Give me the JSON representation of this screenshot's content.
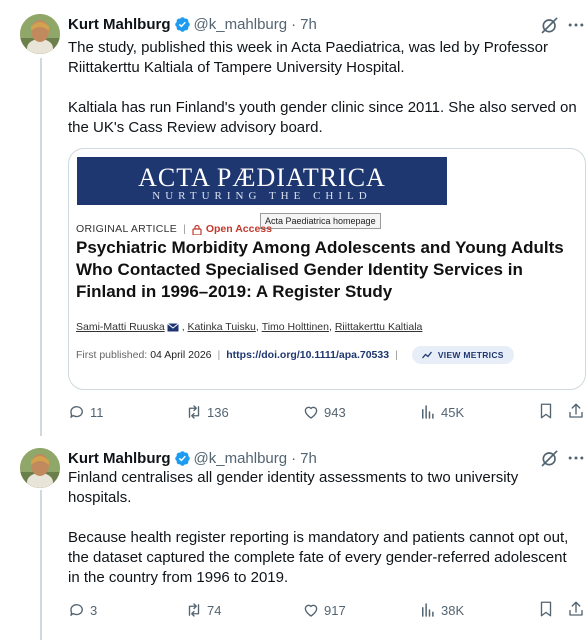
{
  "tweets": [
    {
      "author_name": "Kurt Mahlburg",
      "handle": "@k_mahlburg",
      "separator": "·",
      "time": "7h",
      "text": "The study, published this week in Acta Paediatrica, was led by Professor Riittakerttu Kaltiala of Tampere University Hospital.\n\nKaltiala has run Finland's youth gender clinic since 2011. She also served on the UK's Cass Review advisory board.",
      "card": {
        "journal_title": "ACTA PÆDIATRICA",
        "journal_subtitle": "NURTURING THE CHILD",
        "article_type": "ORIGINAL ARTICLE",
        "separator": "|",
        "access_label": "Open Access",
        "tooltip": "Acta Paediatrica homepage",
        "title": "Psychiatric Morbidity Among Adolescents and Young Adults Who Contacted Specialised Gender Identity Services in Finland in 1996–2019: A Register Study",
        "authors": [
          "Sami-Matti Ruuska",
          "Katinka Tuisku",
          "Timo Holttinen",
          "Riittakerttu Kaltiala"
        ],
        "author_sep": ",",
        "first_published_label": "First published:",
        "first_published_date": "04 April 2026",
        "doi": "https://doi.org/10.1111/apa.70533",
        "metrics_label": "VIEW METRICS"
      },
      "actions": {
        "replies": "11",
        "reposts": "136",
        "likes": "943",
        "views": "45K"
      }
    },
    {
      "author_name": "Kurt Mahlburg",
      "handle": "@k_mahlburg",
      "separator": "·",
      "time": "7h",
      "text": "Finland centralises all gender identity assessments to two university hospitals.\n\nBecause health register reporting is mandatory and patients cannot opt out, the dataset captured the complete fate of every gender-referred adolescent in the country from 1996 to 2019.",
      "actions": {
        "replies": "3",
        "reposts": "74",
        "likes": "917",
        "views": "38K"
      }
    }
  ],
  "colors": {
    "text_primary": "#0f1419",
    "text_secondary": "#536471",
    "verified_blue": "#1d9bf0",
    "journal_navy": "#1f3771",
    "open_access_red": "#c0392b",
    "thread_line": "#cfd9de"
  },
  "icons": [
    "verified-badge-icon",
    "grok-icon",
    "more-icon",
    "reply-icon",
    "repost-icon",
    "like-icon",
    "views-icon",
    "bookmark-icon",
    "share-icon",
    "lock-icon",
    "mail-icon",
    "metrics-chart-icon"
  ]
}
